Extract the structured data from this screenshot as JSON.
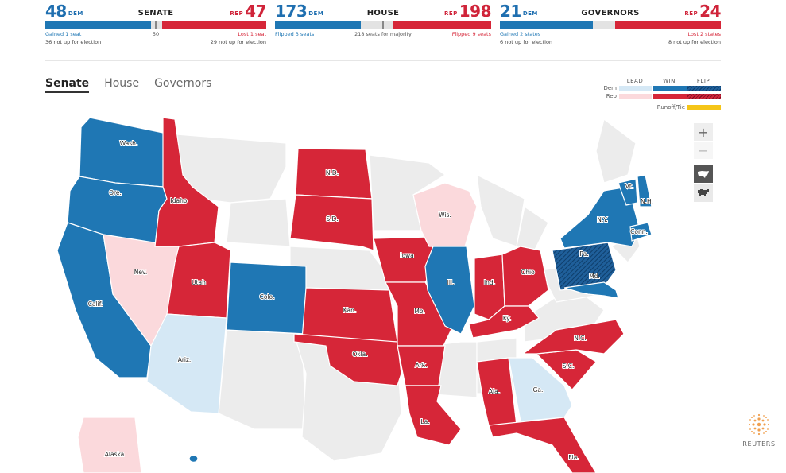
{
  "scoreboards": {
    "senate": {
      "title": "SENATE",
      "dem_count": "48",
      "dem_label": "DEM",
      "rep_count": "47",
      "rep_label": "REP",
      "dem_fraction": 0.48,
      "rep_fraction": 0.47,
      "center_label": "50",
      "dem_note": "Gained 1 seat",
      "rep_note": "Lost 1 seat",
      "dem_note2": "36 not up for election",
      "rep_note2": "29 not up for election"
    },
    "house": {
      "title": "HOUSE",
      "dem_count": "173",
      "dem_label": "DEM",
      "rep_count": "198",
      "rep_label": "REP",
      "dem_fraction": 0.398,
      "rep_fraction": 0.455,
      "center_label": "218 seats for majority",
      "dem_note": "Flipped 3 seats",
      "rep_note": "Flipped 9 seats"
    },
    "governors": {
      "title": "GOVERNORS",
      "dem_count": "21",
      "dem_label": "DEM",
      "rep_count": "24",
      "rep_label": "REP",
      "dem_fraction": 0.42,
      "rep_fraction": 0.48,
      "dem_note": "Gained 2 states",
      "rep_note": "Lost 2 states",
      "dem_note2": "6 not up for election",
      "rep_note2": "8 not up for election"
    }
  },
  "tabs": [
    {
      "label": "Senate",
      "active": true
    },
    {
      "label": "House",
      "active": false
    },
    {
      "label": "Governors",
      "active": false
    }
  ],
  "legend": {
    "headers": [
      "LEAD",
      "WIN",
      "FLIP"
    ],
    "rows": [
      "Dem",
      "Rep"
    ],
    "runoff_label": "Runoff/Tie",
    "colors": {
      "dem_lead": "#d5e8f5",
      "dem_win": "#1f77b4",
      "rep_lead": "#fbd9dc",
      "rep_win": "#d62638",
      "runoff": "#f5c518",
      "none": "#ececec"
    }
  },
  "map_controls": {
    "zoom_in": "+",
    "zoom_out": "−",
    "view_geographic": "us-map-icon",
    "view_cartogram": "cartogram-icon"
  },
  "states": [
    {
      "abbr": "Wash.",
      "status": "dem_win"
    },
    {
      "abbr": "Ore.",
      "status": "dem_win"
    },
    {
      "abbr": "Calif.",
      "status": "dem_win"
    },
    {
      "abbr": "Nev.",
      "status": "rep_lead"
    },
    {
      "abbr": "Idaho",
      "status": "rep_win"
    },
    {
      "abbr": "Utah",
      "status": "rep_win"
    },
    {
      "abbr": "Ariz.",
      "status": "dem_lead"
    },
    {
      "abbr": "Colo.",
      "status": "dem_win"
    },
    {
      "abbr": "N.D.",
      "status": "rep_win"
    },
    {
      "abbr": "S.D.",
      "status": "rep_win"
    },
    {
      "abbr": "Kan.",
      "status": "rep_win"
    },
    {
      "abbr": "Okla.",
      "status": "rep_win"
    },
    {
      "abbr": "Iowa",
      "status": "rep_win"
    },
    {
      "abbr": "Mo.",
      "status": "rep_win"
    },
    {
      "abbr": "Ark.",
      "status": "rep_win"
    },
    {
      "abbr": "La.",
      "status": "rep_win"
    },
    {
      "abbr": "Wis.",
      "status": "rep_lead"
    },
    {
      "abbr": "Ill.",
      "status": "dem_win"
    },
    {
      "abbr": "Ind.",
      "status": "rep_win"
    },
    {
      "abbr": "Ohio",
      "status": "rep_win"
    },
    {
      "abbr": "Ky.",
      "status": "rep_win"
    },
    {
      "abbr": "Ala.",
      "status": "rep_win"
    },
    {
      "abbr": "Ga.",
      "status": "dem_lead"
    },
    {
      "abbr": "Fla.",
      "status": "rep_win"
    },
    {
      "abbr": "S.C.",
      "status": "rep_win"
    },
    {
      "abbr": "N.C.",
      "status": "rep_win"
    },
    {
      "abbr": "Pa.",
      "status": "dem_flip"
    },
    {
      "abbr": "Md.",
      "status": "dem_win"
    },
    {
      "abbr": "N.Y.",
      "status": "dem_win"
    },
    {
      "abbr": "Vt.",
      "status": "dem_win"
    },
    {
      "abbr": "N.H.",
      "status": "dem_win"
    },
    {
      "abbr": "Conn.",
      "status": "dem_win"
    },
    {
      "abbr": "Alaska",
      "status": "rep_lead"
    },
    {
      "abbr": "",
      "status": "dem_win",
      "name": "hawaii"
    }
  ],
  "branding": {
    "name": "REUTERS"
  }
}
